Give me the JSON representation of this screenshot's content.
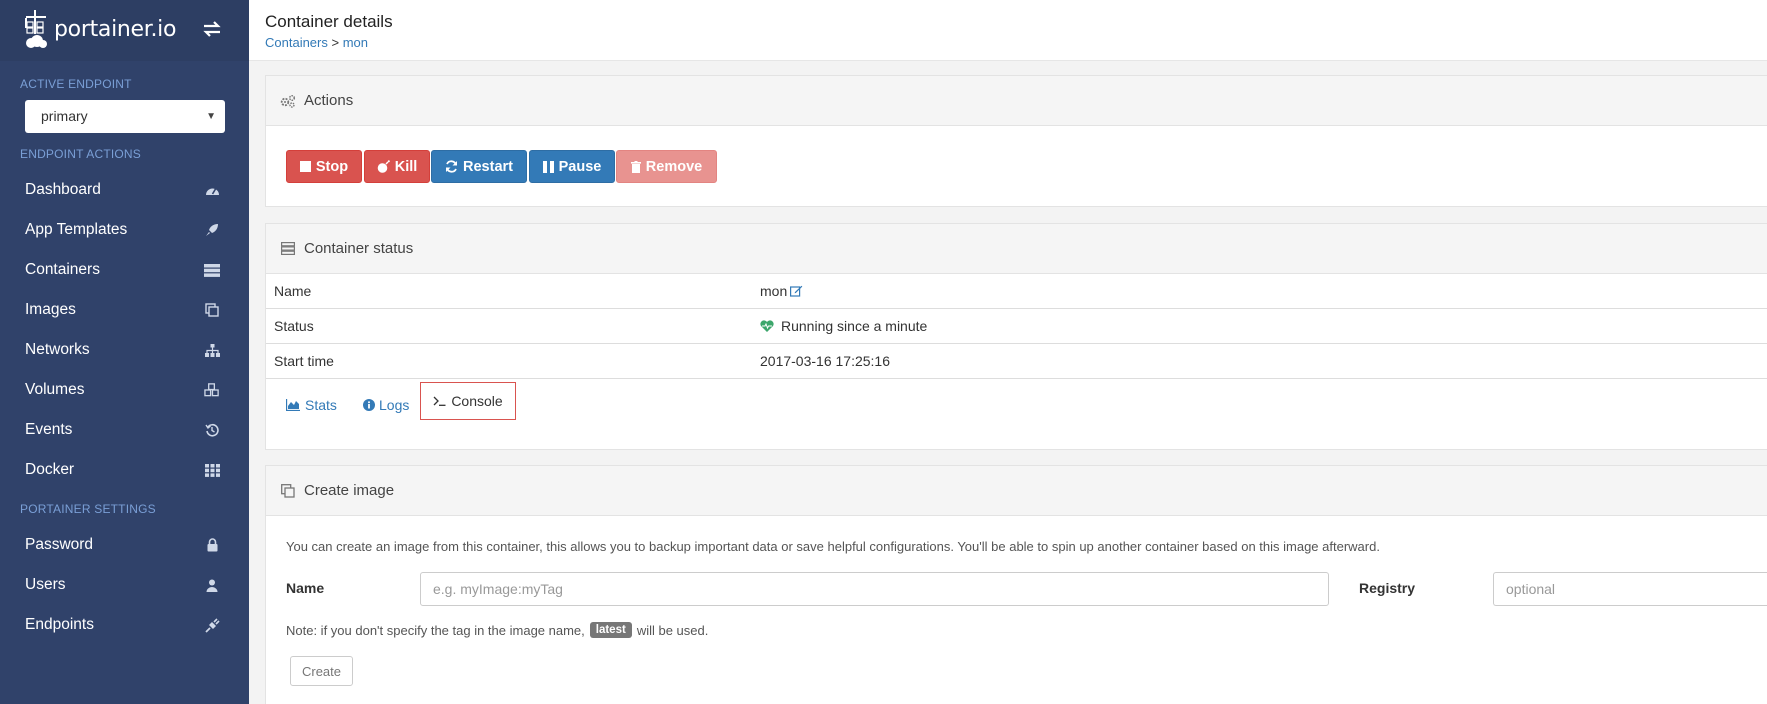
{
  "brand": {
    "name": "portainer.io",
    "logo_icon": "portainer-logo-icon",
    "toggle_icon": "swap-arrows-icon"
  },
  "sidebar": {
    "active_endpoint_title": "ACTIVE ENDPOINT",
    "endpoint_selected": "primary",
    "endpoint_actions_title": "ENDPOINT ACTIONS",
    "items": [
      {
        "label": "Dashboard",
        "icon": "tachometer-icon"
      },
      {
        "label": "App Templates",
        "icon": "rocket-icon"
      },
      {
        "label": "Containers",
        "icon": "server-icon"
      },
      {
        "label": "Images",
        "icon": "clone-icon"
      },
      {
        "label": "Networks",
        "icon": "sitemap-icon"
      },
      {
        "label": "Volumes",
        "icon": "cubes-icon"
      },
      {
        "label": "Events",
        "icon": "history-icon"
      },
      {
        "label": "Docker",
        "icon": "th-icon"
      }
    ],
    "settings_title": "PORTAINER SETTINGS",
    "settings_items": [
      {
        "label": "Password",
        "icon": "lock-icon"
      },
      {
        "label": "Users",
        "icon": "user-icon"
      },
      {
        "label": "Endpoints",
        "icon": "plug-icon"
      }
    ]
  },
  "header": {
    "title": "Container details",
    "breadcrumb_link": "Containers",
    "breadcrumb_sep": ">",
    "breadcrumb_current": "mon"
  },
  "actions": {
    "title": "Actions",
    "stop": "Stop",
    "kill": "Kill",
    "restart": "Restart",
    "pause": "Pause",
    "remove": "Remove"
  },
  "status": {
    "title": "Container status",
    "rows": [
      {
        "label": "Name",
        "value": "mon"
      },
      {
        "label": "Status",
        "value": "Running since a minute"
      },
      {
        "label": "Start time",
        "value": "2017-03-16 17:25:16"
      }
    ],
    "links": {
      "stats": "Stats",
      "logs": "Logs",
      "console": "Console"
    }
  },
  "create_image": {
    "title": "Create image",
    "description": "You can create an image from this container, this allows you to backup important data or save helpful configurations. You'll be able to spin up another container based on this image afterward.",
    "name_label": "Name",
    "name_placeholder": "e.g. myImage:myTag",
    "registry_label": "Registry",
    "registry_placeholder": "optional",
    "note_prefix": "Note: if you don't specify the tag in the image name,",
    "note_badge": "latest",
    "note_suffix": "will be used.",
    "create_button": "Create"
  },
  "colors": {
    "sidebar_bg": "#30426a",
    "danger": "#d9534f",
    "primary": "#337ab7",
    "running": "#3ca66b"
  }
}
